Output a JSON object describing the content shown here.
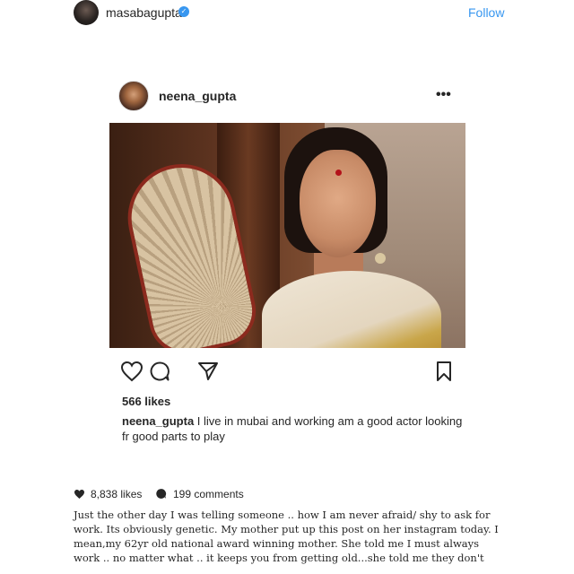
{
  "outer_post": {
    "username": "masabagupta",
    "follow_label": "Follow",
    "likes_text": "8,838 likes",
    "comments_text": "199 comments",
    "caption": "Just the other day I was telling someone .. how I am never afraid/ shy to ask for work. Its obviously genetic. My mother put up this post on her instagram today. I mean,my 62yr old national award winning mother. She told me I must always work .. no matter what .. it keeps you from getting old...she told me they don't"
  },
  "inner_post": {
    "username": "neena_gupta",
    "more_label": "•••",
    "likes_text": "566 likes",
    "caption_user": "neena_gupta",
    "caption_text": " I live in mubai and working am a good actor looking fr good parts to play"
  },
  "icons": {
    "verified": "verified-badge-icon",
    "more": "more-options-icon",
    "heart": "heart-icon",
    "comment": "comment-icon",
    "share": "share-icon",
    "bookmark": "bookmark-icon"
  },
  "colors": {
    "link_blue": "#3897f0",
    "text": "#262626"
  }
}
